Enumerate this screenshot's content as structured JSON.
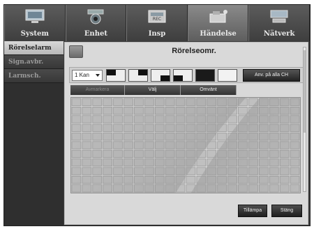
{
  "tabs": [
    {
      "label": "System",
      "icon": "monitor-icon"
    },
    {
      "label": "Enhet",
      "icon": "camera-icon"
    },
    {
      "label": "Insp",
      "icon": "recorder-icon"
    },
    {
      "label": "Händelse",
      "icon": "event-camera-icon"
    },
    {
      "label": "Nätverk",
      "icon": "network-icon"
    }
  ],
  "active_tab": "Händelse",
  "sidebar": {
    "items": [
      {
        "label": "Rörelselarm",
        "active": true
      },
      {
        "label": "Sign.avbr.",
        "active": false
      },
      {
        "label": "Larmsch.",
        "active": false
      }
    ]
  },
  "panel": {
    "title": "Rörelseomr.",
    "channel_select": "1 Kan",
    "apply_all_label": "Anv. på alla CH",
    "modes": [
      {
        "label": "Avmarkera",
        "enabled": false
      },
      {
        "label": "Välj",
        "enabled": true
      },
      {
        "label": "Omvänt",
        "enabled": true
      }
    ],
    "apply_label": "Tillämpa",
    "close_label": "Stäng"
  },
  "colors": {
    "tab_bg": "#4a4a4a",
    "panel_bg": "#d9d9d9",
    "grid_line": "#9a9a9a",
    "button_bg": "#2a2a2a"
  }
}
